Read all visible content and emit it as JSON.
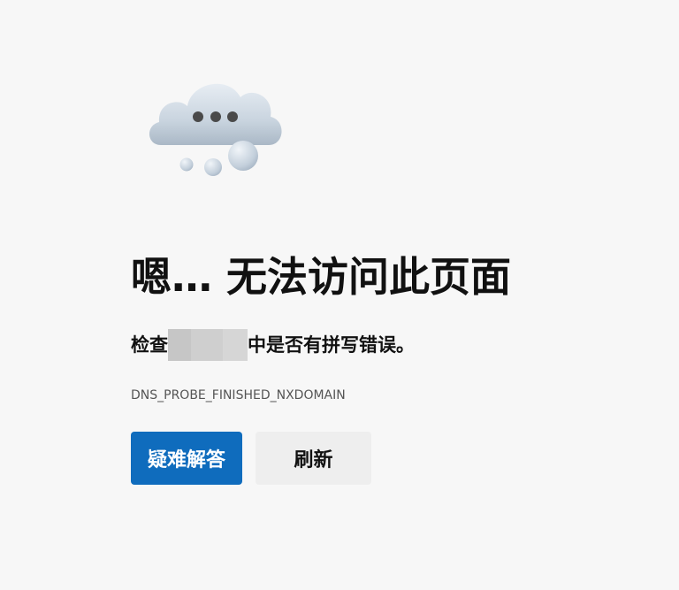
{
  "error_page": {
    "title": "嗯… 无法访问此页面",
    "subtitle_prefix": "检查",
    "subtitle_suffix": "中是否有拼写错误。",
    "error_code": "DNS_PROBE_FINISHED_NXDOMAIN",
    "illustration": "cloud-with-ellipsis-icon"
  },
  "buttons": {
    "troubleshoot_label": "疑难解答",
    "refresh_label": "刷新"
  },
  "colors": {
    "background": "#f7f7f7",
    "primary_button": "#0f6cbd",
    "secondary_button": "#eeeeee",
    "error_code_text": "#555555"
  }
}
